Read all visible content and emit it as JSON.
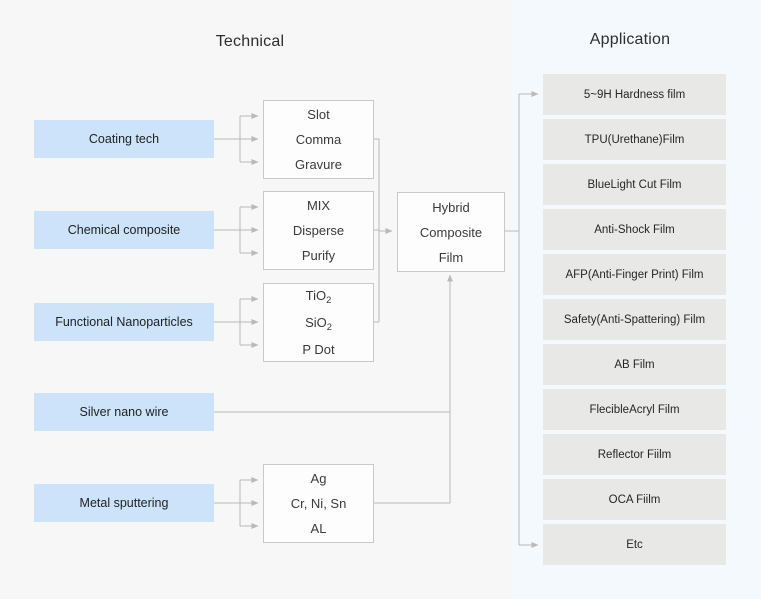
{
  "columns": {
    "technical_title": "Technical",
    "application_title": "Application"
  },
  "colors": {
    "source_box": "#cce3fa",
    "process_box": "#fdfdfd",
    "application_box": "#e8e8e6",
    "connector": "#b9b9b9",
    "background_left": "#f7f7f7",
    "background_right": "#f4f9fd"
  },
  "sources": [
    {
      "label": "Coating tech"
    },
    {
      "label": "Chemical composite"
    },
    {
      "label": "Functional Nanoparticles"
    },
    {
      "label": "Silver nano wire"
    },
    {
      "label": "Metal sputtering"
    }
  ],
  "processes": [
    {
      "lines": [
        "Slot",
        "Comma",
        "Gravure"
      ]
    },
    {
      "lines": [
        "MIX",
        "Disperse",
        "Purify"
      ]
    },
    {
      "lines": [
        "TiO2",
        "SiO2",
        "P Dot"
      ]
    },
    {
      "lines": [
        "Ag",
        "Cr, Ni, Sn",
        "AL"
      ]
    }
  ],
  "process_text": {
    "p0l0": "Slot",
    "p0l1": "Comma",
    "p0l2": "Gravure",
    "p1l0": "MIX",
    "p1l1": "Disperse",
    "p1l2": "Purify",
    "p2l0_base": "TiO",
    "p2l0_sub": "2",
    "p2l1_base": "SiO",
    "p2l1_sub": "2",
    "p2l2": "P Dot",
    "p3l0": "Ag",
    "p3l1": "Cr, Ni, Sn",
    "p3l2": "AL"
  },
  "hybrid": {
    "line1": "Hybrid",
    "line2": "Composite",
    "line3": "Film"
  },
  "applications": [
    {
      "label": "5~9H Hardness film"
    },
    {
      "label": "TPU(Urethane)Film"
    },
    {
      "label": "BlueLight Cut Film"
    },
    {
      "label": "Anti-Shock Film"
    },
    {
      "label": "AFP(Anti-Finger Print) Film"
    },
    {
      "label": "Safety(Anti-Spattering) Film"
    },
    {
      "label": "AB Film"
    },
    {
      "label": "FlecibleAcryl Film"
    },
    {
      "label": "Reflector Fiilm"
    },
    {
      "label": "OCA Fiilm"
    },
    {
      "label": "Etc"
    }
  ]
}
